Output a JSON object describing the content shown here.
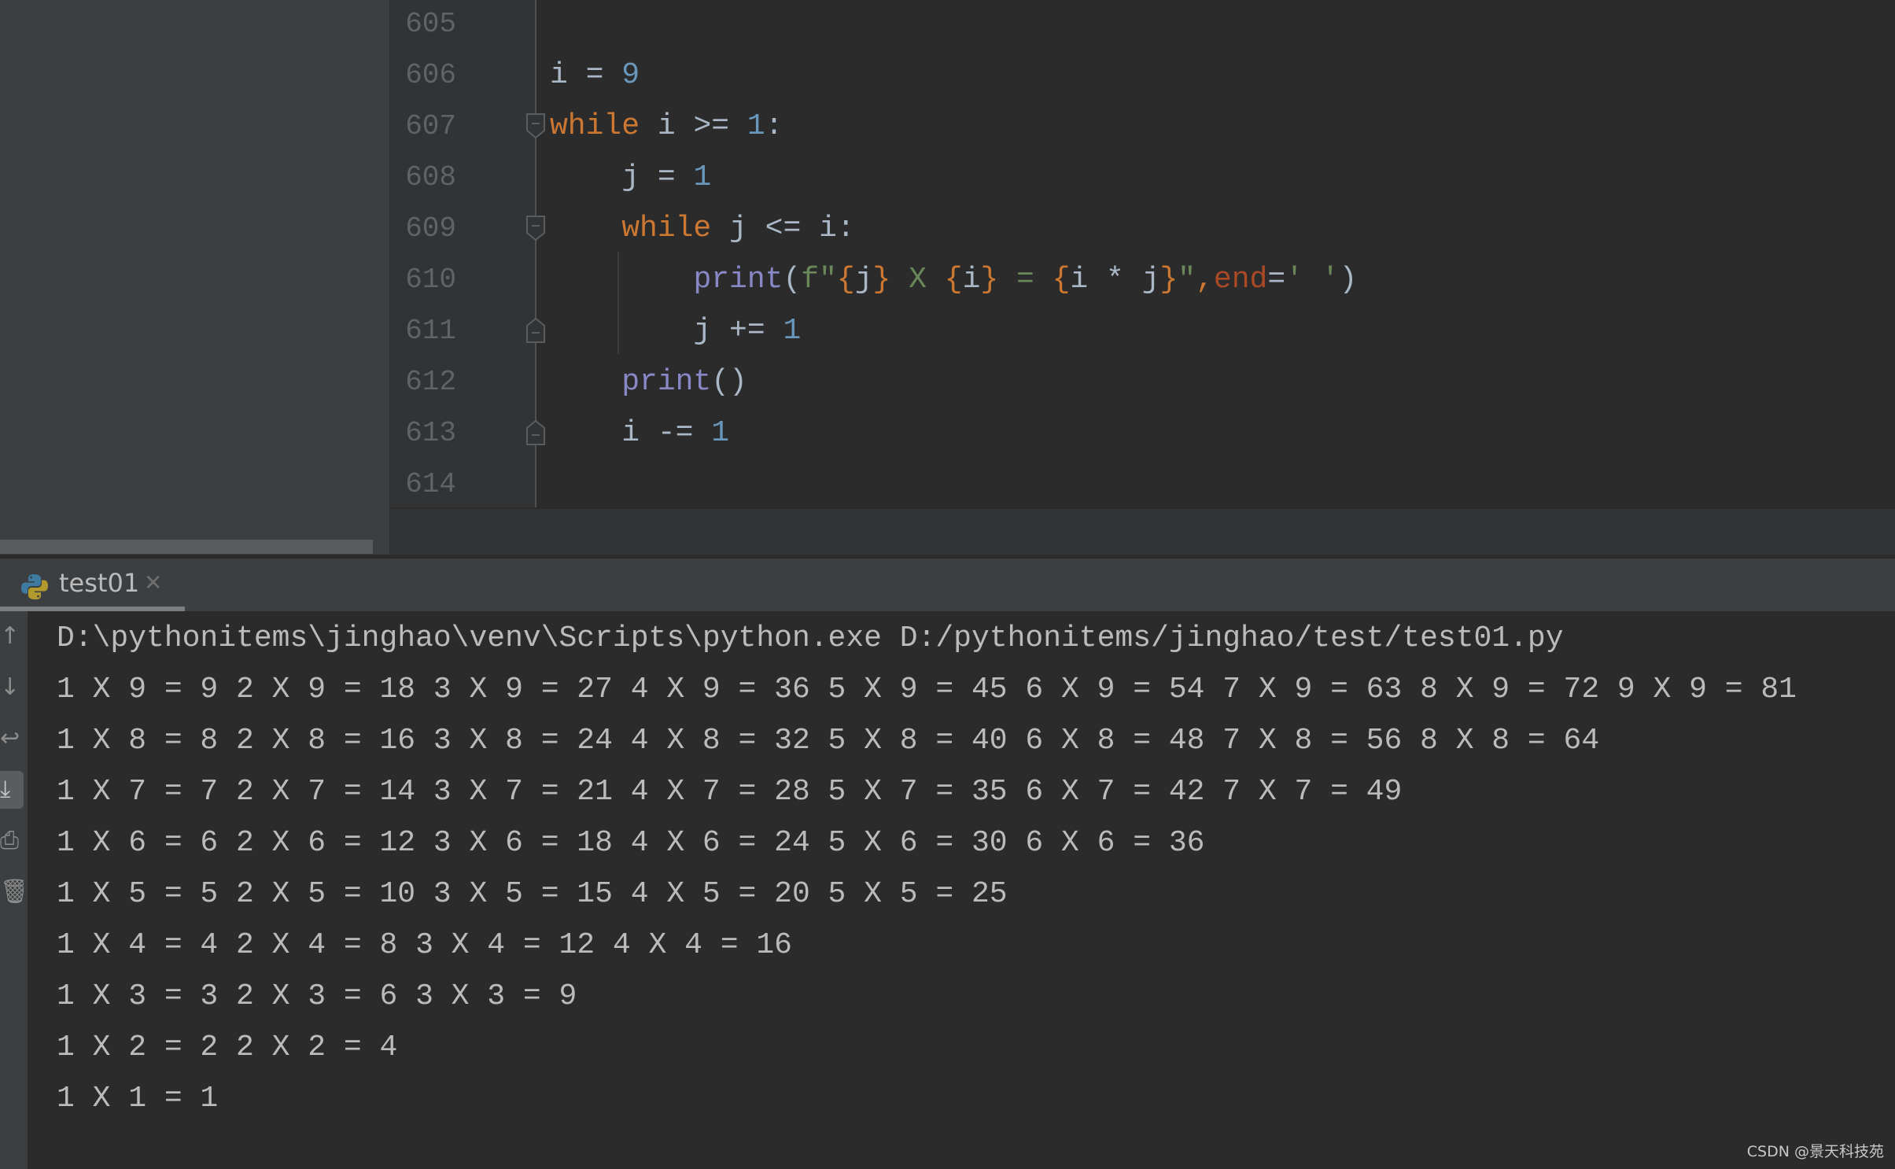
{
  "editor": {
    "lines": [
      {
        "num": "605",
        "tokens": []
      },
      {
        "num": "606",
        "tokens": [
          {
            "t": "i = ",
            "c": ""
          },
          {
            "t": "9",
            "c": "num"
          }
        ]
      },
      {
        "num": "607",
        "tokens": [
          {
            "t": "while",
            "c": "kw"
          },
          {
            "t": " i >= ",
            "c": ""
          },
          {
            "t": "1",
            "c": "num"
          },
          {
            "t": ":",
            "c": ""
          }
        ]
      },
      {
        "num": "608",
        "tokens": [
          {
            "t": "    j = ",
            "c": ""
          },
          {
            "t": "1",
            "c": "num"
          }
        ]
      },
      {
        "num": "609",
        "tokens": [
          {
            "t": "    ",
            "c": ""
          },
          {
            "t": "while",
            "c": "kw"
          },
          {
            "t": " j <= i:",
            "c": ""
          }
        ]
      },
      {
        "num": "610",
        "tokens": [
          {
            "t": "        ",
            "c": ""
          },
          {
            "t": "print",
            "c": "fn"
          },
          {
            "t": "(",
            "c": ""
          },
          {
            "t": "f\"",
            "c": "str"
          },
          {
            "t": "{",
            "c": "brace"
          },
          {
            "t": "j",
            "c": ""
          },
          {
            "t": "}",
            "c": "brace"
          },
          {
            "t": " X ",
            "c": "str"
          },
          {
            "t": "{",
            "c": "brace"
          },
          {
            "t": "i",
            "c": ""
          },
          {
            "t": "}",
            "c": "brace"
          },
          {
            "t": " = ",
            "c": "str"
          },
          {
            "t": "{",
            "c": "brace"
          },
          {
            "t": "i * j",
            "c": ""
          },
          {
            "t": "}",
            "c": "brace"
          },
          {
            "t": "\"",
            "c": "str"
          },
          {
            "t": ",",
            "c": "kw"
          },
          {
            "t": "end",
            "c": "kwarg"
          },
          {
            "t": "=",
            "c": ""
          },
          {
            "t": "' '",
            "c": "str"
          },
          {
            "t": ")",
            "c": ""
          }
        ]
      },
      {
        "num": "611",
        "tokens": [
          {
            "t": "        j += ",
            "c": ""
          },
          {
            "t": "1",
            "c": "num"
          }
        ]
      },
      {
        "num": "612",
        "tokens": [
          {
            "t": "    ",
            "c": ""
          },
          {
            "t": "print",
            "c": "fn"
          },
          {
            "t": "()",
            "c": ""
          }
        ]
      },
      {
        "num": "613",
        "tokens": [
          {
            "t": "    i -= ",
            "c": ""
          },
          {
            "t": "1",
            "c": "num"
          }
        ]
      },
      {
        "num": "614",
        "tokens": []
      }
    ],
    "fold_markers": [
      {
        "line": "607",
        "type": "fold-start"
      },
      {
        "line": "609",
        "type": "fold-start"
      },
      {
        "line": "611",
        "type": "fold-end"
      },
      {
        "line": "613",
        "type": "fold-end"
      }
    ]
  },
  "run_panel": {
    "tab": {
      "label": "test01",
      "icon": "python-icon",
      "close_icon": "close-icon"
    },
    "toolbar": [
      {
        "name": "up-arrow-icon",
        "glyph": "↑",
        "active": false
      },
      {
        "name": "down-arrow-icon",
        "glyph": "↓",
        "active": false
      },
      {
        "name": "soft-wrap-icon",
        "glyph": "↩",
        "active": false
      },
      {
        "name": "scroll-to-end-icon",
        "glyph": "⤓",
        "active": true
      },
      {
        "name": "print-icon",
        "glyph": "⎙",
        "active": false
      },
      {
        "name": "trash-icon",
        "glyph": "🗑",
        "active": false
      }
    ],
    "console_lines": [
      "D:\\pythonitems\\jinghao\\venv\\Scripts\\python.exe D:/pythonitems/jinghao/test/test01.py",
      "1 X 9 = 9 2 X 9 = 18 3 X 9 = 27 4 X 9 = 36 5 X 9 = 45 6 X 9 = 54 7 X 9 = 63 8 X 9 = 72 9 X 9 = 81",
      "1 X 8 = 8 2 X 8 = 16 3 X 8 = 24 4 X 8 = 32 5 X 8 = 40 6 X 8 = 48 7 X 8 = 56 8 X 8 = 64",
      "1 X 7 = 7 2 X 7 = 14 3 X 7 = 21 4 X 7 = 28 5 X 7 = 35 6 X 7 = 42 7 X 7 = 49",
      "1 X 6 = 6 2 X 6 = 12 3 X 6 = 18 4 X 6 = 24 5 X 6 = 30 6 X 6 = 36",
      "1 X 5 = 5 2 X 5 = 10 3 X 5 = 15 4 X 5 = 20 5 X 5 = 25",
      "1 X 4 = 4 2 X 4 = 8 3 X 4 = 12 4 X 4 = 16",
      "1 X 3 = 3 2 X 3 = 6 3 X 3 = 9",
      "1 X 2 = 2 2 X 2 = 4",
      "1 X 1 = 1"
    ]
  },
  "watermark": "CSDN @景天科技苑"
}
